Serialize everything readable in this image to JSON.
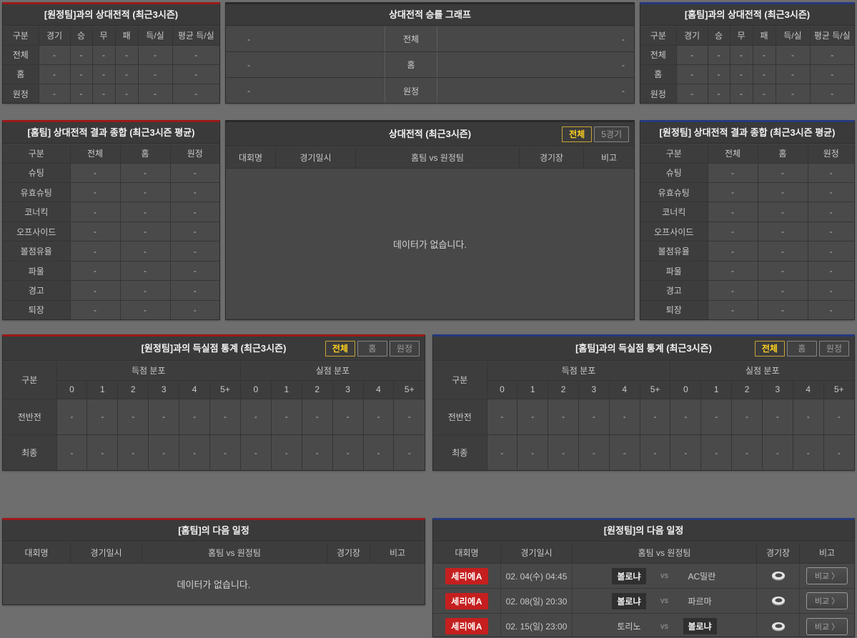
{
  "colors": {
    "accent_red": "#9c1a1a",
    "accent_blue": "#25397f",
    "league_badge_red": "#c51f1f",
    "active_tab_yellow": "#ffd21e"
  },
  "h2h_away": {
    "title": "[원정팀]과의 상대전적 (최근3시즌)",
    "columns": [
      "구분",
      "경기",
      "승",
      "무",
      "패",
      "득/실",
      "평균 득/실"
    ],
    "rows": [
      {
        "label": "전체",
        "values": [
          "-",
          "-",
          "-",
          "-",
          "-",
          "-"
        ]
      },
      {
        "label": "홈",
        "values": [
          "-",
          "-",
          "-",
          "-",
          "-",
          "-"
        ]
      },
      {
        "label": "원정",
        "values": [
          "-",
          "-",
          "-",
          "-",
          "-",
          "-"
        ]
      }
    ]
  },
  "winrate_graph": {
    "title": "상대전적 승률 그래프",
    "rows": [
      {
        "label": "전체",
        "left": "-",
        "right": "-"
      },
      {
        "label": "홈",
        "left": "-",
        "right": "-"
      },
      {
        "label": "원정",
        "left": "-",
        "right": "-"
      }
    ]
  },
  "h2h_home": {
    "title": "[홈팀]과의 상대전적 (최근3시즌)",
    "columns": [
      "구분",
      "경기",
      "승",
      "무",
      "패",
      "득/실",
      "평균 득/실"
    ],
    "rows": [
      {
        "label": "전체",
        "values": [
          "-",
          "-",
          "-",
          "-",
          "-",
          "-"
        ]
      },
      {
        "label": "홈",
        "values": [
          "-",
          "-",
          "-",
          "-",
          "-",
          "-"
        ]
      },
      {
        "label": "원정",
        "values": [
          "-",
          "-",
          "-",
          "-",
          "-",
          "-"
        ]
      }
    ]
  },
  "summary_home": {
    "title": "[홈팀] 상대전적 결과 종합 (최근3시즌 평균)",
    "columns": [
      "구분",
      "전체",
      "홈",
      "원정"
    ],
    "rows": [
      {
        "label": "슈팅",
        "values": [
          "-",
          "-",
          "-"
        ]
      },
      {
        "label": "유효슈팅",
        "values": [
          "-",
          "-",
          "-"
        ]
      },
      {
        "label": "코너킥",
        "values": [
          "-",
          "-",
          "-"
        ]
      },
      {
        "label": "오프사이드",
        "values": [
          "-",
          "-",
          "-"
        ]
      },
      {
        "label": "볼점유율",
        "values": [
          "-",
          "-",
          "-"
        ]
      },
      {
        "label": "파울",
        "values": [
          "-",
          "-",
          "-"
        ]
      },
      {
        "label": "경고",
        "values": [
          "-",
          "-",
          "-"
        ]
      },
      {
        "label": "퇴장",
        "values": [
          "-",
          "-",
          "-"
        ]
      }
    ]
  },
  "h2h_matches": {
    "title": "상대전적 (최근3시즌)",
    "tabs": [
      {
        "label": "전체",
        "active": true
      },
      {
        "label": "5경기",
        "active": false
      }
    ],
    "columns": [
      "대회명",
      "경기일시",
      "홈팀  vs  원정팀",
      "경기장",
      "비고"
    ],
    "empty": "데이터가 없습니다."
  },
  "summary_away": {
    "title": "[원정팀] 상대전적 결과 종합 (최근3시즌 평균)",
    "columns": [
      "구분",
      "전체",
      "홈",
      "원정"
    ],
    "rows": [
      {
        "label": "슈팅",
        "values": [
          "-",
          "-",
          "-"
        ]
      },
      {
        "label": "유효슈팅",
        "values": [
          "-",
          "-",
          "-"
        ]
      },
      {
        "label": "코너킥",
        "values": [
          "-",
          "-",
          "-"
        ]
      },
      {
        "label": "오프사이드",
        "values": [
          "-",
          "-",
          "-"
        ]
      },
      {
        "label": "볼점유율",
        "values": [
          "-",
          "-",
          "-"
        ]
      },
      {
        "label": "파울",
        "values": [
          "-",
          "-",
          "-"
        ]
      },
      {
        "label": "경고",
        "values": [
          "-",
          "-",
          "-"
        ]
      },
      {
        "label": "퇴장",
        "values": [
          "-",
          "-",
          "-"
        ]
      }
    ]
  },
  "goals_vs_away": {
    "title": "[원정팀]과의 득실점 통계 (최근3시즌)",
    "tabs": [
      {
        "label": "전체",
        "active": true
      },
      {
        "label": "홈",
        "active": false
      },
      {
        "label": "원정",
        "active": false
      }
    ],
    "corner": "구분",
    "groups": [
      "득점 분포",
      "실점 분포"
    ],
    "bins": [
      "0",
      "1",
      "2",
      "3",
      "4",
      "5+"
    ],
    "rows": [
      {
        "label": "전반전",
        "goals": [
          "-",
          "-",
          "-",
          "-",
          "-",
          "-"
        ],
        "conceded": [
          "-",
          "-",
          "-",
          "-",
          "-",
          "-"
        ]
      },
      {
        "label": "최종",
        "goals": [
          "-",
          "-",
          "-",
          "-",
          "-",
          "-"
        ],
        "conceded": [
          "-",
          "-",
          "-",
          "-",
          "-",
          "-"
        ]
      }
    ]
  },
  "goals_vs_home": {
    "title": "[홈팀]과의 득실점 통계 (최근3시즌)",
    "tabs": [
      {
        "label": "전체",
        "active": true
      },
      {
        "label": "홈",
        "active": false
      },
      {
        "label": "원정",
        "active": false
      }
    ],
    "corner": "구분",
    "groups": [
      "득점 분포",
      "실점 분포"
    ],
    "bins": [
      "0",
      "1",
      "2",
      "3",
      "4",
      "5+"
    ],
    "rows": [
      {
        "label": "전반전",
        "goals": [
          "-",
          "-",
          "-",
          "-",
          "-",
          "-"
        ],
        "conceded": [
          "-",
          "-",
          "-",
          "-",
          "-",
          "-"
        ]
      },
      {
        "label": "최종",
        "goals": [
          "-",
          "-",
          "-",
          "-",
          "-",
          "-"
        ],
        "conceded": [
          "-",
          "-",
          "-",
          "-",
          "-",
          "-"
        ]
      }
    ]
  },
  "next_home": {
    "title": "[홈팀]의 다음 일정",
    "columns": [
      "대회명",
      "경기일시",
      "홈팀  vs  원정팀",
      "경기장",
      "비고"
    ],
    "empty": "데이터가 없습니다."
  },
  "next_away": {
    "title": "[원정팀]의 다음 일정",
    "columns": [
      "대회명",
      "경기일시",
      "홈팀  vs  원정팀",
      "경기장",
      "비고"
    ],
    "compare_label": "비교 〉",
    "matches": [
      {
        "league": "세리에A",
        "datetime": "02. 04(수) 04:45",
        "home": "볼로냐",
        "away": "AC밀란",
        "home_hl": true,
        "away_hl": false
      },
      {
        "league": "세리에A",
        "datetime": "02. 08(일) 20:30",
        "home": "볼로냐",
        "away": "파르마",
        "home_hl": true,
        "away_hl": false
      },
      {
        "league": "세리에A",
        "datetime": "02. 15(일) 23:00",
        "home": "토리노",
        "away": "볼로냐",
        "home_hl": false,
        "away_hl": true
      }
    ]
  }
}
